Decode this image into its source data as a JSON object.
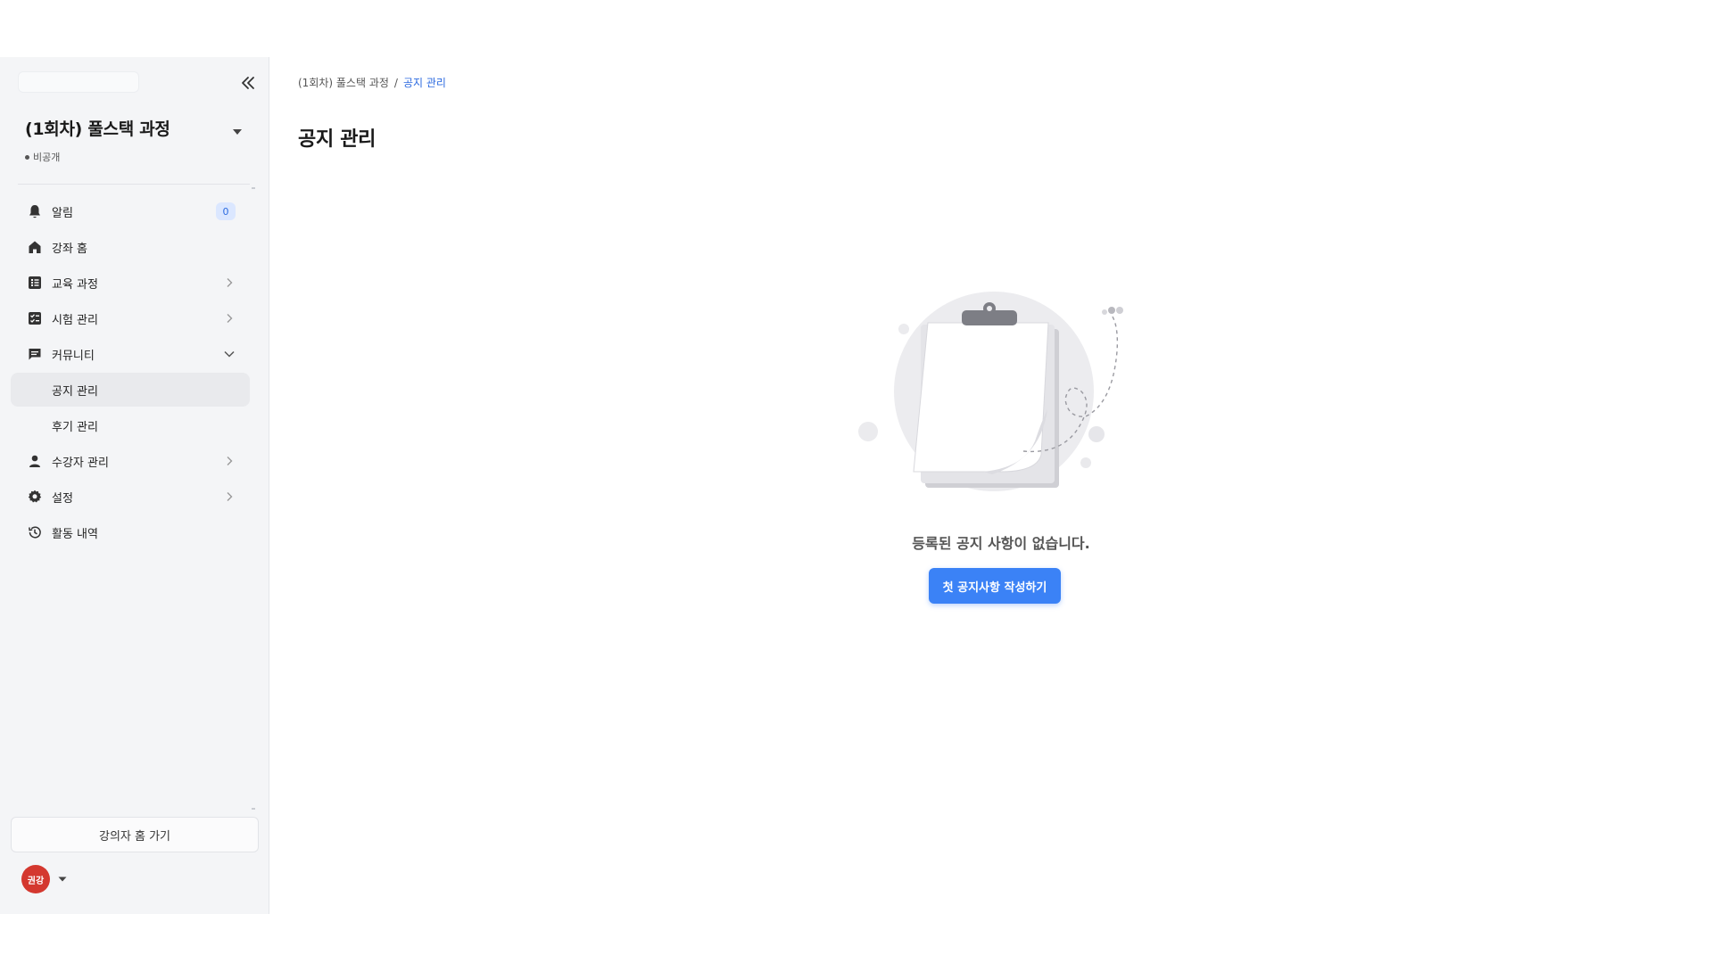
{
  "sidebar": {
    "course_title": "(1회차) 풀스택 과정",
    "visibility": "비공개",
    "nav": {
      "alerts": {
        "label": "알림",
        "badge": "0"
      },
      "course_home": {
        "label": "강좌 홈"
      },
      "curriculum": {
        "label": "교육 과정"
      },
      "exam": {
        "label": "시험 관리"
      },
      "community": {
        "label": "커뮤니티"
      },
      "notice": {
        "label": "공지 관리"
      },
      "review": {
        "label": "후기 관리"
      },
      "students": {
        "label": "수강자 관리"
      },
      "settings": {
        "label": "설정"
      },
      "activity": {
        "label": "활동 내역"
      }
    },
    "instructor_home": "강의자 홈 가기",
    "user_initials": "권강"
  },
  "main": {
    "breadcrumb": {
      "parent": "(1회차) 풀스택 과정",
      "separator": "/",
      "current": "공지 관리"
    },
    "title": "공지 관리",
    "empty_message": "등록된 공지 사항이 없습니다.",
    "cta": "첫 공지사항 작성하기"
  },
  "colors": {
    "accent": "#3b82f6",
    "breadcrumb_active": "#2d6be0",
    "avatar": "#d4382f",
    "sidebar_bg": "#f4f5f7"
  }
}
